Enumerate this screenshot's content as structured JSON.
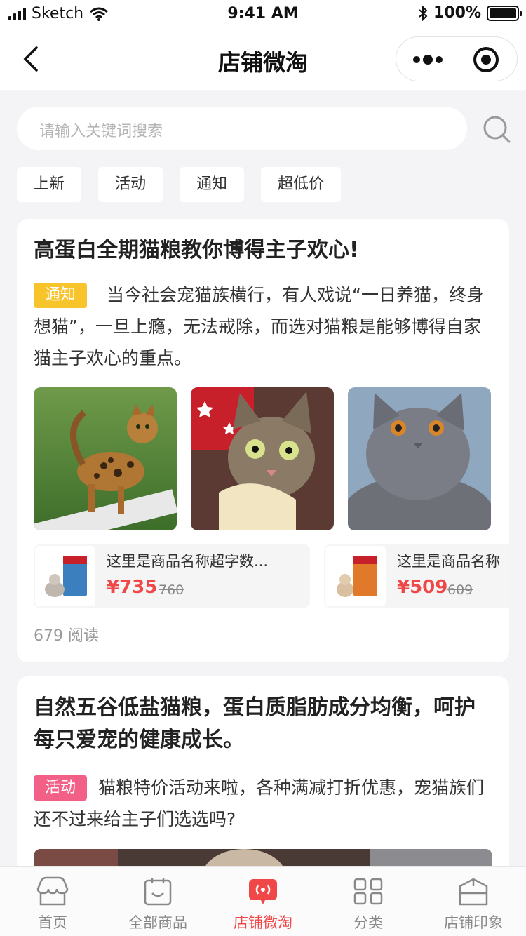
{
  "status_bar": {
    "carrier": "Sketch",
    "time": "9:41 AM",
    "battery": "100%"
  },
  "nav": {
    "title": "店铺微淘"
  },
  "search": {
    "placeholder": "请输入关键词搜索"
  },
  "tags": [
    "上新",
    "活动",
    "通知",
    "超低价"
  ],
  "posts": [
    {
      "title": "高蛋白全期猫粮教你博得主子欢心!",
      "badge": "通知",
      "badge_color": "#f8c42c",
      "desc": "当今社会宠猫族横行，有人戏说“一日养猫，终身想猫”，一旦上瘾，无法戒除，而选对猫粮是能够博得自家猫主子欢心的重点。",
      "products": [
        {
          "name": "这里是商品名称超字数...",
          "price": "¥735",
          "original_price": "760"
        },
        {
          "name": "这里是商品名称",
          "price": "¥509",
          "original_price": "609"
        }
      ],
      "reads": "679 阅读"
    },
    {
      "title": "自然五谷低盐猫粮，蛋白质脂肪成分均衡，呵护每只爱宠的健康成长。",
      "badge": "活动",
      "badge_color": "#f25f87",
      "desc": "猫粮特价活动来啦，各种满减打折优惠，宠猫族们还不过来给主子们选选吗?"
    }
  ],
  "tabbar": {
    "active_color": "#f04848",
    "items": [
      {
        "label": "首页",
        "icon": "store-icon"
      },
      {
        "label": "全部商品",
        "icon": "bag-icon"
      },
      {
        "label": "店铺微淘",
        "icon": "broadcast-icon"
      },
      {
        "label": "分类",
        "icon": "category-icon"
      },
      {
        "label": "店铺印象",
        "icon": "store-impression-icon"
      }
    ]
  }
}
